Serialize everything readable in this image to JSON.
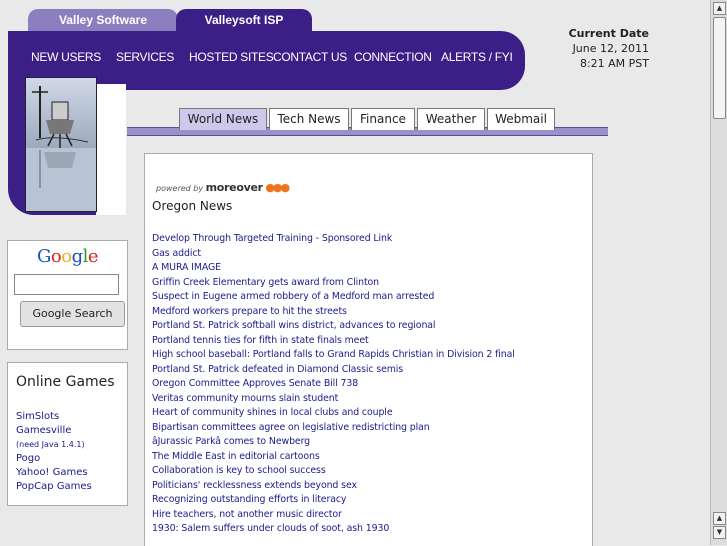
{
  "header": {
    "tabs": [
      "Valley Software",
      "Valleysoft ISP"
    ],
    "nav": [
      "NEW USERS",
      "SERVICES",
      "HOSTED SITES",
      "CONTACT US",
      "CONNECTION",
      "ALERTS / FYI"
    ]
  },
  "date": {
    "label": "Current Date",
    "date": "June 12, 2011",
    "time": "8:21 AM PST"
  },
  "news_tabs": {
    "items": [
      "World News",
      "Tech News",
      "Finance",
      "Weather",
      "Webmail"
    ],
    "active": "World News"
  },
  "google": {
    "logo": "Google",
    "search_value": "",
    "button": "Google Search",
    "logo_colors": [
      "#1a4fc1",
      "#d9261c",
      "#e8b11a",
      "#1a4fc1",
      "#2e9a2e",
      "#d9261c"
    ]
  },
  "games": {
    "title": "Online Games",
    "items": [
      "SimSlots",
      "Gamesville",
      "(need Java 1.4.1)",
      "Pogo",
      "Yahoo! Games",
      "PopCap Games"
    ]
  },
  "news": {
    "powered_by": "powered by",
    "provider": "moreover",
    "title": "Oregon News",
    "items": [
      "Develop Through Targeted Training - Sponsored Link",
      "Gas addict",
      "A MURA IMAGE",
      "Griffin Creek Elementary gets award from Clinton",
      "Suspect in Eugene armed robbery of a Medford man arrested",
      "Medford workers prepare to hit the streets",
      "Portland St. Patrick softball wins district, advances to regional",
      "Portland tennis ties for fifth in state finals meet",
      "High school baseball: Portland falls to Grand Rapids Christian in Division 2 final",
      "Portland St. Patrick defeated in Diamond Classic semis",
      "Oregon Committee Approves Senate Bill 738",
      "Veritas community mourns slain student",
      "Heart of community shines in local clubs and couple",
      "Bipartisan committees agree on legislative redistricting plan",
      "âJurassic Parkâ comes to Newberg",
      "The Middle East in editorial cartoons",
      "Collaboration is key to school success",
      "Politicians' recklessness extends beyond sex",
      "Recognizing outstanding efforts in literacy",
      "Hire teachers, not another music director",
      "1930: Salem suffers under clouds of soot, ash 1930"
    ]
  }
}
